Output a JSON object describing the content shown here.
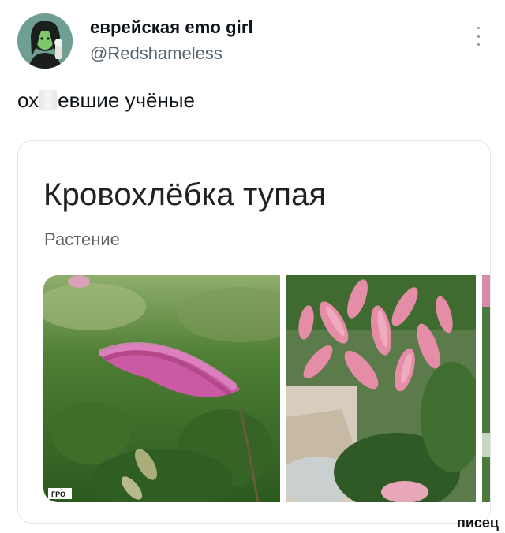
{
  "author": {
    "display_name": "еврейская emo girl",
    "handle": "@Redshameless"
  },
  "tweet": {
    "text_before": "ох",
    "text_after": "евшие учёные"
  },
  "card": {
    "title": "Кровохлёбка тупая",
    "subtitle": "Растение",
    "image1_caption": "ГРО"
  },
  "watermark": "писец",
  "icons": {
    "more": "more-vertical-icon",
    "avatar": "avatar-image"
  }
}
